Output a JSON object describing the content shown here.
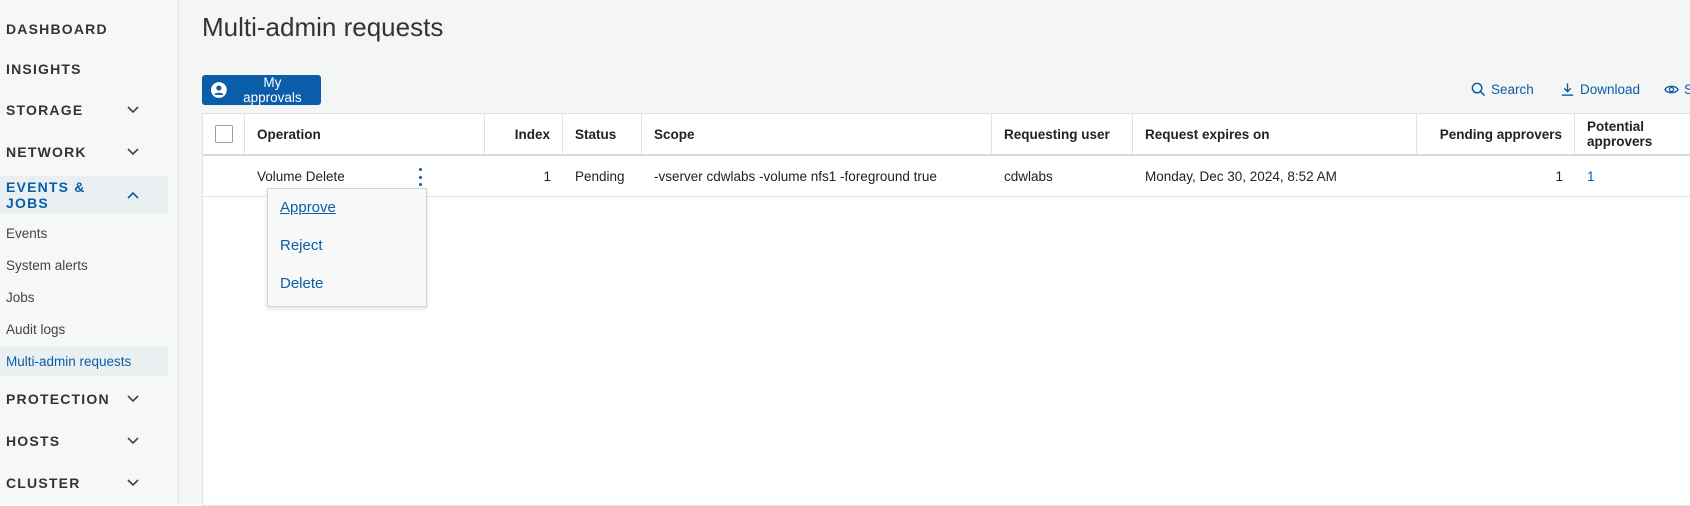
{
  "sidebar": {
    "sections": [
      {
        "label": "DASHBOARD",
        "expandable": false
      },
      {
        "label": "INSIGHTS",
        "expandable": false
      },
      {
        "label": "STORAGE",
        "expandable": true
      },
      {
        "label": "NETWORK",
        "expandable": true
      },
      {
        "label": "EVENTS & JOBS",
        "expandable": true,
        "expanded": true
      },
      {
        "label": "PROTECTION",
        "expandable": true
      },
      {
        "label": "HOSTS",
        "expandable": true
      },
      {
        "label": "CLUSTER",
        "expandable": true
      }
    ],
    "events_jobs_items": [
      "Events",
      "System alerts",
      "Jobs",
      "Audit logs",
      "Multi-admin requests"
    ],
    "active_item": "Multi-admin requests"
  },
  "page": {
    "title": "Multi-admin requests",
    "my_approvals_label": "My approvals",
    "toolbar": {
      "search_label": "Search",
      "download_label": "Download",
      "show_label": "S"
    }
  },
  "table": {
    "columns": [
      "Operation",
      "Index",
      "Status",
      "Scope",
      "Requesting user",
      "Request expires on",
      "Pending approvers",
      "Potential approvers"
    ],
    "rows": [
      {
        "operation": "Volume Delete",
        "index": "1",
        "status": "Pending",
        "scope": "-vserver cdwlabs -volume nfs1 -foreground true",
        "requesting_user": "cdwlabs",
        "expires_on": "Monday, Dec 30, 2024, 8:52 AM",
        "pending_approvers": "1",
        "potential_approvers": "1"
      }
    ]
  },
  "row_menu": {
    "items": [
      "Approve",
      "Reject",
      "Delete"
    ]
  },
  "colors": {
    "accent": "#0a5da8",
    "sidebar_bg": "#f6f8f7",
    "main_bg": "#f3f6f4"
  }
}
